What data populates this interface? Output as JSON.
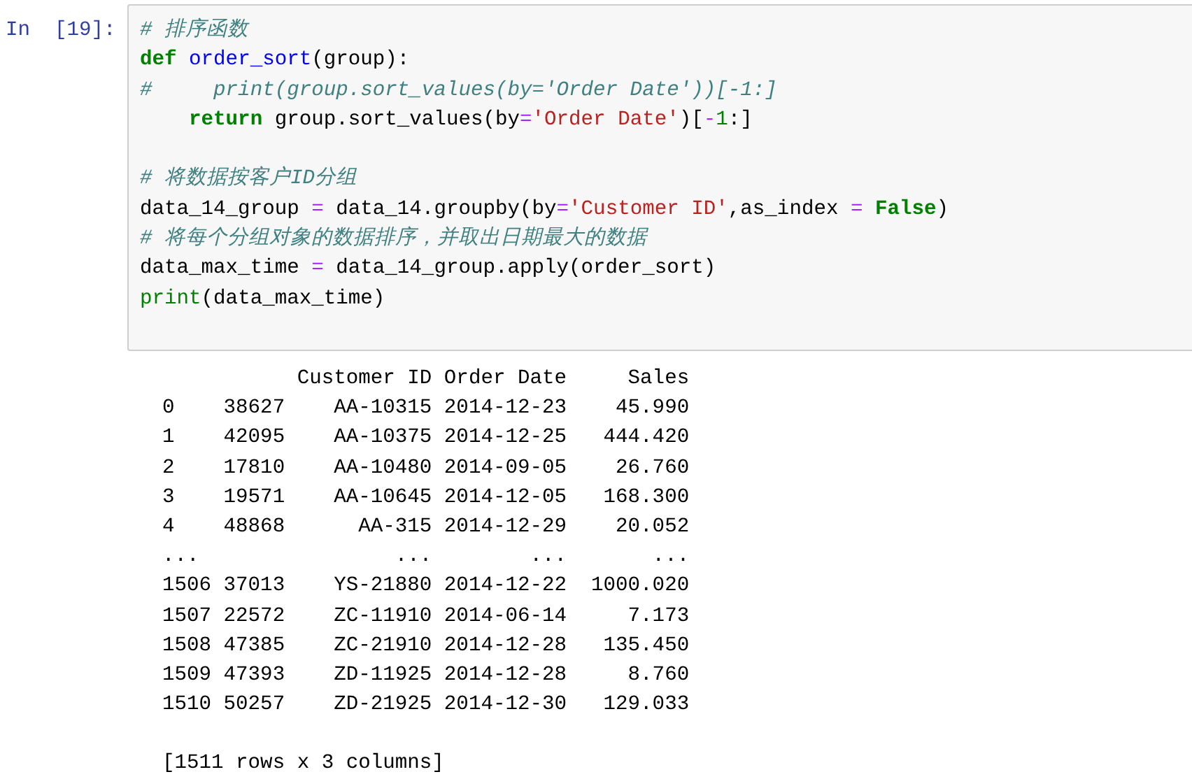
{
  "cell": {
    "prompt": "In  [19]:",
    "code_lines": [
      {
        "tokens": [
          {
            "kind": "comment",
            "text": "# 排序函数"
          }
        ]
      },
      {
        "tokens": [
          {
            "kind": "keyword",
            "text": "def"
          },
          {
            "kind": "function",
            "text": " order_sort"
          },
          {
            "kind": "plain",
            "text": "(group):"
          }
        ]
      },
      {
        "tokens": [
          {
            "kind": "comment",
            "text": "#     print(group.sort_values(by='Order Date'))[-1:]"
          }
        ]
      },
      {
        "tokens": [
          {
            "kind": "keyword",
            "text": "    return"
          },
          {
            "kind": "plain",
            "text": " group.sort_values(by"
          },
          {
            "kind": "operator",
            "text": "="
          },
          {
            "kind": "string",
            "text": "'Order Date'"
          },
          {
            "kind": "plain",
            "text": ")["
          },
          {
            "kind": "operator",
            "text": "-"
          },
          {
            "kind": "number",
            "text": "1"
          },
          {
            "kind": "plain",
            "text": ":]"
          }
        ]
      },
      {
        "blank_before": true,
        "tokens": [
          {
            "kind": "comment",
            "text": "# 将数据按客户ID分组"
          }
        ]
      },
      {
        "tokens": [
          {
            "kind": "plain",
            "text": "data_14_group "
          },
          {
            "kind": "operator",
            "text": "="
          },
          {
            "kind": "plain",
            "text": " data_14.groupby(by"
          },
          {
            "kind": "operator",
            "text": "="
          },
          {
            "kind": "string",
            "text": "'Customer ID'"
          },
          {
            "kind": "plain",
            "text": ",as_index "
          },
          {
            "kind": "operator",
            "text": "="
          },
          {
            "kind": "keyword",
            "text": " False"
          },
          {
            "kind": "plain",
            "text": ")"
          }
        ]
      },
      {
        "tokens": [
          {
            "kind": "comment",
            "text": "# 将每个分组对象的数据排序，并取出日期最大的数据"
          }
        ]
      },
      {
        "tokens": [
          {
            "kind": "plain",
            "text": "data_max_time "
          },
          {
            "kind": "operator",
            "text": "="
          },
          {
            "kind": "plain",
            "text": " data_14_group.apply(order_sort)"
          }
        ]
      },
      {
        "tokens": [
          {
            "kind": "builtin",
            "text": "print"
          },
          {
            "kind": "plain",
            "text": "(data_max_time)"
          }
        ]
      }
    ]
  },
  "output": {
    "lines": [
      {
        "text": "           Customer ID Order Date     Sales"
      },
      {
        "text": "0    38627    AA-10315 2014-12-23    45.990"
      },
      {
        "text": "1    42095    AA-10375 2014-12-25   444.420"
      },
      {
        "text": "2    17810    AA-10480 2014-09-05    26.760"
      },
      {
        "text": "3    19571    AA-10645 2014-12-05   168.300"
      },
      {
        "text": "4    48868      AA-315 2014-12-29    20.052"
      },
      {
        "text": "...                ...        ...       ..."
      },
      {
        "text": "1506 37013    YS-21880 2014-12-22  1000.020"
      },
      {
        "text": "1507 22572    ZC-11910 2014-06-14     7.173"
      },
      {
        "text": "1508 47385    ZC-21910 2014-12-28   135.450"
      },
      {
        "text": "1509 47393    ZD-11925 2014-12-28     8.760"
      },
      {
        "text": "1510 50257    ZD-21925 2014-12-30   129.033"
      },
      {
        "text": "[1511 rows x 3 columns]",
        "blank_before": true
      }
    ]
  }
}
